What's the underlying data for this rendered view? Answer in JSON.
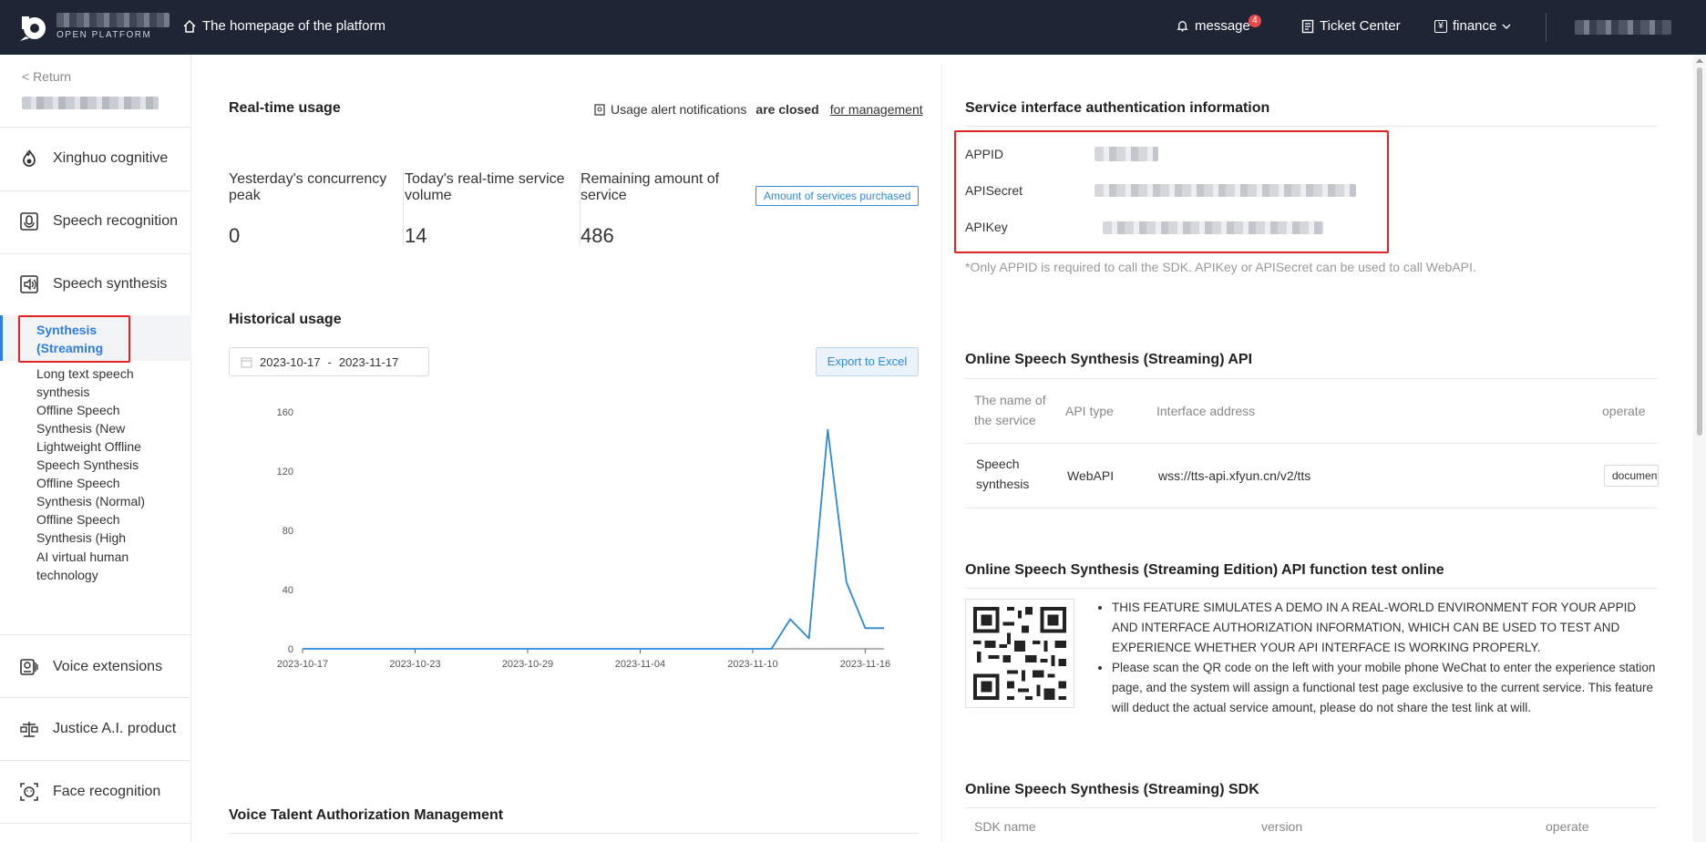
{
  "topbar": {
    "logo_sub": "OPEN PLATFORM",
    "home_link": "The homepage of the platform",
    "message_label": "message",
    "message_count": "4",
    "ticket_center": "Ticket Center",
    "finance_label": "finance",
    "finance_icon": "¥"
  },
  "sidebar": {
    "return_label": "< Return",
    "categories": [
      {
        "label": "Xinghuo cognitive",
        "icon": "fire-icon"
      },
      {
        "label": "Speech recognition",
        "icon": "microphone-icon"
      },
      {
        "label": "Speech synthesis",
        "icon": "speaker-icon"
      },
      {
        "label": "Voice extensions",
        "icon": "voice-extension-icon"
      },
      {
        "label": "Justice A.I. product",
        "icon": "scales-icon"
      },
      {
        "label": "Face recognition",
        "icon": "face-icon"
      }
    ],
    "active_sub": "Synthesis (Streaming",
    "sub_items": [
      "Long text speech synthesis",
      "Offline Speech Synthesis (New Version)",
      "Lightweight Offline Speech Synthesis (New Edition)",
      "Offline Speech Synthesis (Normal)",
      "Offline Speech Synthesis (High Quality)",
      "AI virtual human technology"
    ]
  },
  "realtime": {
    "title": "Real-time usage",
    "alert_text": "Usage alert notifications",
    "alert_status": "are closed",
    "alert_link": "for management",
    "stats": [
      {
        "label": "Yesterday's concurrency peak",
        "value": "0"
      },
      {
        "label": "Today's real-time service volume",
        "value": "14"
      },
      {
        "label": "Remaining amount of service",
        "value": "486"
      }
    ],
    "purchased_btn": "Amount of services purchased"
  },
  "historical": {
    "title": "Historical usage",
    "date_start": "2023-10-17",
    "date_end": "2023-11-17",
    "date_sep": "-",
    "export_btn": "Export to Excel"
  },
  "chart_data": {
    "type": "line",
    "x_ticks": [
      "2023-10-17",
      "2023-10-23",
      "2023-10-29",
      "2023-11-04",
      "2023-11-10",
      "2023-11-16"
    ],
    "y_ticks": [
      0,
      40,
      80,
      120,
      160
    ],
    "ylim": [
      0,
      160
    ],
    "series": [
      {
        "color": "#2e88d8",
        "x": [
          "2023-10-17",
          "2023-10-18",
          "2023-10-19",
          "2023-10-20",
          "2023-10-21",
          "2023-10-22",
          "2023-10-23",
          "2023-10-24",
          "2023-10-25",
          "2023-10-26",
          "2023-10-27",
          "2023-10-28",
          "2023-10-29",
          "2023-10-30",
          "2023-10-31",
          "2023-11-01",
          "2023-11-02",
          "2023-11-03",
          "2023-11-04",
          "2023-11-05",
          "2023-11-06",
          "2023-11-07",
          "2023-11-08",
          "2023-11-09",
          "2023-11-10",
          "2023-11-11",
          "2023-11-12",
          "2023-11-13",
          "2023-11-14",
          "2023-11-15",
          "2023-11-16",
          "2023-11-17"
        ],
        "values": [
          0,
          0,
          0,
          0,
          0,
          0,
          0,
          0,
          0,
          0,
          0,
          0,
          0,
          0,
          0,
          0,
          0,
          0,
          0,
          0,
          0,
          0,
          0,
          0,
          0,
          0,
          20,
          7,
          148,
          45,
          14,
          14
        ]
      }
    ]
  },
  "voice_talent": {
    "title": "Voice Talent Authorization Management"
  },
  "auth": {
    "title": "Service interface authentication information",
    "fields": [
      "APPID",
      "APISecret",
      "APIKey"
    ],
    "note": "*Only APPID is required to call the SDK. APIKey or APISecret can be used to call WebAPI."
  },
  "api": {
    "title": "Online Speech Synthesis (Streaming) API",
    "headers": [
      "The name of the service",
      "API type",
      "Interface address",
      "operate"
    ],
    "row": {
      "service": "Speech synthesis",
      "type": "WebAPI",
      "address": "wss://tts-api.xfyun.cn/v2/tts",
      "operate": "document"
    }
  },
  "test": {
    "title": "Online Speech Synthesis (Streaming Edition) API function test online",
    "bullet1": "THIS FEATURE SIMULATES A DEMO IN A REAL-WORLD ENVIRONMENT FOR YOUR APPID AND INTERFACE AUTHORIZATION INFORMATION, WHICH CAN BE USED TO TEST AND EXPERIENCE WHETHER YOUR API INTERFACE IS WORKING PROPERLY.",
    "bullet2": "Please scan the QR code on the left with your mobile phone WeChat to enter the experience station page, and the system will assign a functional test page exclusive to the current service. This feature will deduct the actual service amount, please do not share the test link at will."
  },
  "sdk": {
    "title": "Online Speech Synthesis (Streaming) SDK",
    "headers": [
      "SDK name",
      "version",
      "operate"
    ]
  }
}
